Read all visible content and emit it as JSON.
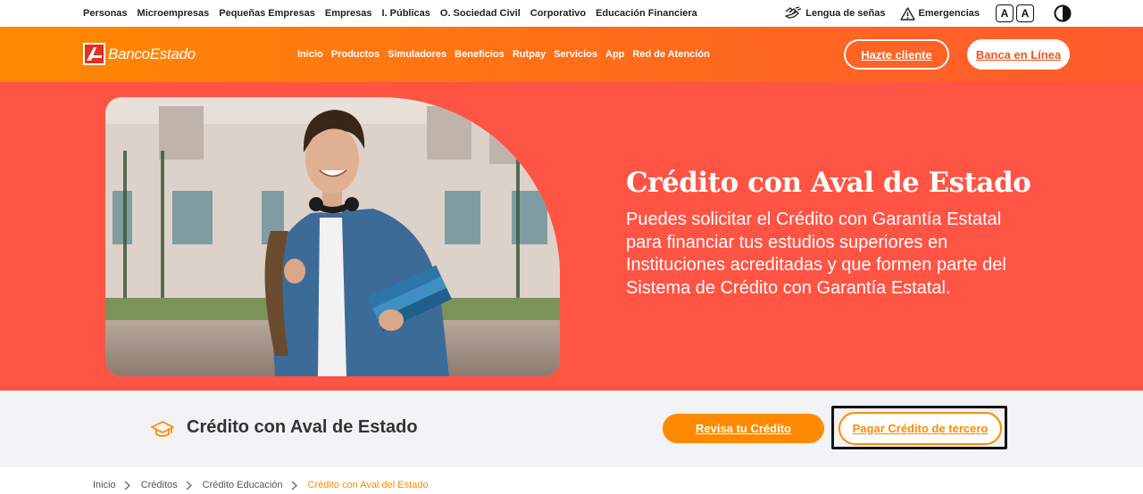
{
  "topbar": {
    "nav": [
      "Personas",
      "Microempresas",
      "Pequeñas Empresas",
      "Empresas",
      "I. Públicas",
      "O. Sociedad Civil",
      "Corporativo",
      "Educación Financiera"
    ],
    "sign_language_label": "Lengua de señas",
    "emergencies_label": "Emergencias",
    "font_size_buttons": [
      "A",
      "A"
    ],
    "icons": {
      "sign_language": "sign-language-icon",
      "emergencies": "warning-icon",
      "contrast": "contrast-icon"
    }
  },
  "header": {
    "logo_text": "BancoEstado",
    "nav": [
      "Inicio",
      "Productos",
      "Simuladores",
      "Beneficios",
      "Rutpay",
      "Servicios",
      "App",
      "Red de Atención"
    ],
    "become_client_label": "Hazte cliente",
    "online_banking_label": "Banca en Línea"
  },
  "hero": {
    "title": "Crédito con Aval de Estado",
    "description": "Puedes solicitar el Crédito con Garantía Estatal para financiar tus estudios superiores en Instituciones acreditadas y que formen parte del Sistema de Crédito con Garantía Estatal."
  },
  "product_bar": {
    "icon": "graduation-cap-icon",
    "title": "Crédito con Aval de Estado",
    "review_credit_label": "Revisa tu Crédito",
    "pay_third_party_label": "Pagar Crédito de tercero"
  },
  "breadcrumb": {
    "items": [
      "Inicio",
      "Créditos",
      "Crédito Educación"
    ],
    "current": "Crédito con Aval del Estado"
  },
  "colors": {
    "brand_orange": "#ff8a00",
    "hero_background": "#ff5444",
    "header_gradient_end": "#ff5a2e",
    "product_bar_background": "#f2f3f5"
  }
}
